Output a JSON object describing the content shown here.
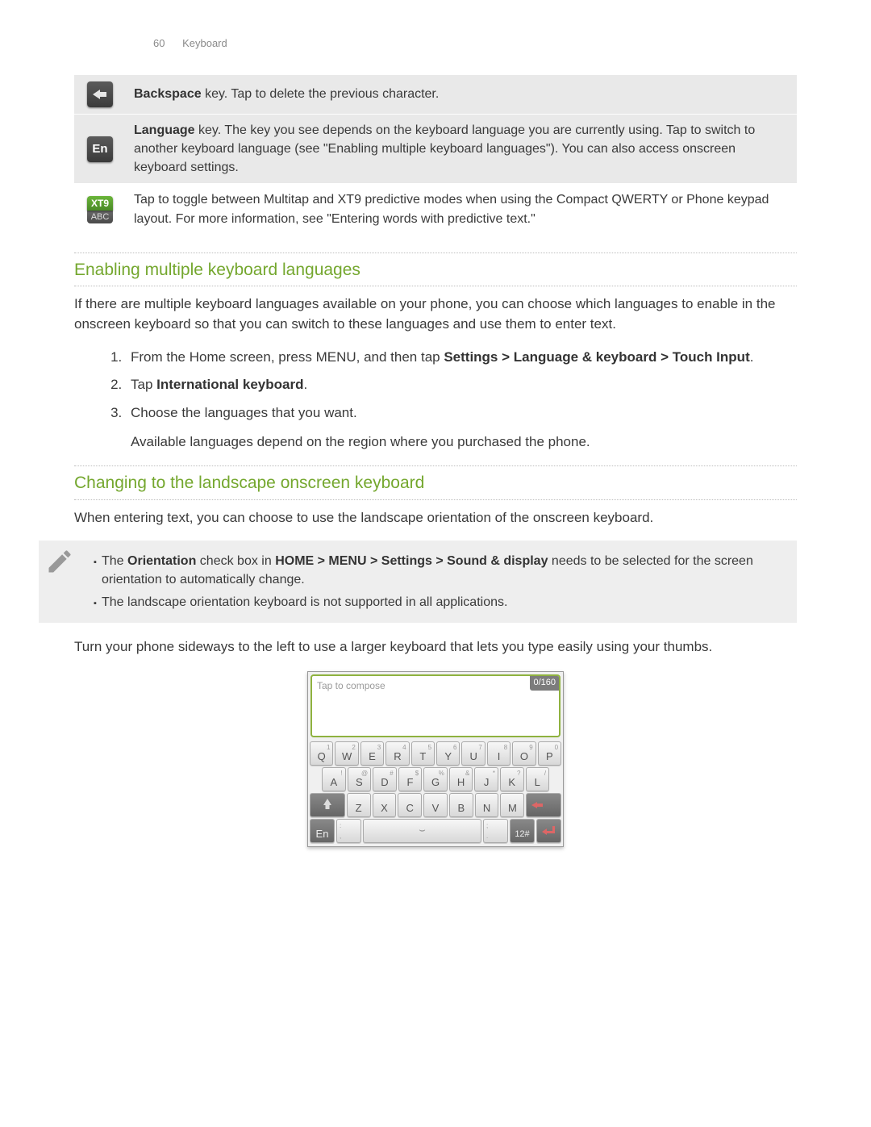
{
  "header": {
    "page_num": "60",
    "section": "Keyboard"
  },
  "key_table": {
    "rows": [
      {
        "icon": "backspace",
        "bold": "Backspace",
        "desc": " key. Tap to delete the previous character."
      },
      {
        "icon": "en",
        "en_label": "En",
        "bold": "Language",
        "desc": " key. The key you see depends on the keyboard language you are currently using. Tap to switch to another keyboard language (see \"Enabling multiple keyboard languages\"). You can also access onscreen keyboard settings."
      },
      {
        "icon": "xt9",
        "xt9_label": "XT9",
        "abc_label": "ABC",
        "desc": "Tap to toggle between Multitap and XT9 predictive modes when using the Compact QWERTY or Phone keypad layout. For more information, see \"Entering words with predictive text.\""
      }
    ]
  },
  "section1": {
    "title": "Enabling multiple keyboard languages",
    "intro": "If there are multiple keyboard languages available on your phone, you can choose which languages to enable in the onscreen keyboard so that you can switch to these languages and use them to enter text.",
    "step1_a": "From the Home screen, press MENU, and then tap ",
    "step1_b": "Settings > Language & keyboard > Touch Input",
    "step1_c": ".",
    "step2_a": "Tap ",
    "step2_b": "International keyboard",
    "step2_c": ".",
    "step3": "Choose the languages that you want.",
    "step3_note": "Available languages depend on the region where you purchased the phone."
  },
  "section2": {
    "title": "Changing to the landscape onscreen keyboard",
    "intro": "When entering text, you can choose to use the landscape orientation of the onscreen keyboard.",
    "note1_a": "The ",
    "note1_b": "Orientation",
    "note1_c": " check box in ",
    "note1_d": "HOME > MENU > Settings > Sound & display",
    "note1_e": " needs to be selected for the screen orientation to automatically change.",
    "note2": "The landscape orientation keyboard is not supported in all applications.",
    "outro": "Turn your phone sideways to the left to use a larger keyboard that lets you type easily using your thumbs."
  },
  "keyboard_fig": {
    "placeholder": "Tap to compose",
    "counter": "0/160",
    "row1": [
      {
        "alt": "1",
        "main": "Q"
      },
      {
        "alt": "2",
        "main": "W"
      },
      {
        "alt": "3",
        "main": "E"
      },
      {
        "alt": "4",
        "main": "R"
      },
      {
        "alt": "5",
        "main": "T"
      },
      {
        "alt": "6",
        "main": "Y"
      },
      {
        "alt": "7",
        "main": "U"
      },
      {
        "alt": "8",
        "main": "I"
      },
      {
        "alt": "9",
        "main": "O"
      },
      {
        "alt": "0",
        "main": "P"
      }
    ],
    "row2": [
      {
        "alt": "!",
        "main": "A"
      },
      {
        "alt": "@",
        "main": "S"
      },
      {
        "alt": "#",
        "main": "D"
      },
      {
        "alt": "$",
        "main": "F"
      },
      {
        "alt": "%",
        "main": "G"
      },
      {
        "alt": "&",
        "main": "H"
      },
      {
        "alt": "*",
        "main": "J"
      },
      {
        "alt": "?",
        "main": "K"
      },
      {
        "alt": "/",
        "main": "L"
      }
    ],
    "row3": [
      {
        "main": "Z"
      },
      {
        "main": "X"
      },
      {
        "main": "C"
      },
      {
        "main": "V"
      },
      {
        "main": "B"
      },
      {
        "main": "N"
      },
      {
        "main": "M"
      }
    ],
    "en_label": "En",
    "sym_label": "12#"
  }
}
